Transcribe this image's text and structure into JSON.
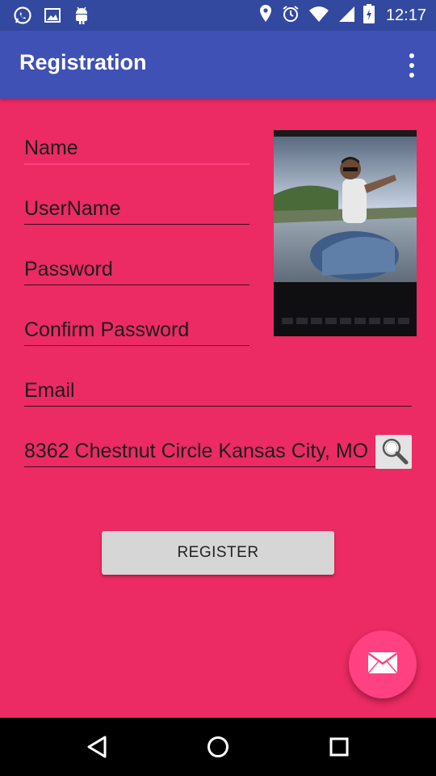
{
  "status_bar": {
    "time": "12:17",
    "left_icons": [
      "whatsapp-icon",
      "image-icon",
      "android-icon"
    ],
    "right_icons": [
      "location-icon",
      "alarm-icon",
      "wifi-icon",
      "signal-icon",
      "battery-icon"
    ]
  },
  "app_bar": {
    "title": "Registration",
    "overflow_icon": "more-vert-icon"
  },
  "form": {
    "name_placeholder": "Name",
    "username_placeholder": "UserName",
    "password_placeholder": "Password",
    "confirm_password_placeholder": "Confirm Password",
    "email_placeholder": "Email",
    "address_value": "8362 Chestnut Circle Kansas City, MO",
    "search_icon": "search-icon",
    "register_label": "REGISTER"
  },
  "fab": {
    "icon": "email-icon"
  },
  "nav_bar": {
    "icons": [
      "back-icon",
      "home-icon",
      "recents-icon"
    ]
  },
  "colors": {
    "background": "#EC2A63",
    "app_bar": "#3F51B5",
    "status_bar": "#3349A0",
    "accent": "#FF4081"
  }
}
